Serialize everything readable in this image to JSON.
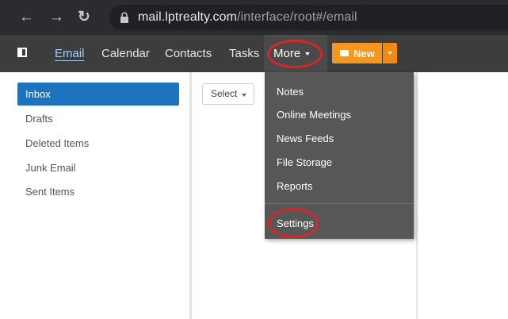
{
  "browser": {
    "url_host": "mail.lptrealty.com",
    "url_path": "/interface/root#/email"
  },
  "nav": {
    "items": [
      "Email",
      "Calendar",
      "Contacts",
      "Tasks"
    ],
    "more_label": "More",
    "new_label": "New"
  },
  "sidebar": {
    "folders": [
      "Inbox",
      "Drafts",
      "Deleted Items",
      "Junk Email",
      "Sent Items"
    ],
    "selected": "Inbox"
  },
  "list": {
    "select_label": "Select"
  },
  "more_menu": {
    "items": [
      "Notes",
      "Online Meetings",
      "News Feeds",
      "File Storage",
      "Reports"
    ],
    "settings": "Settings"
  },
  "colors": {
    "accent_blue": "#1e73be",
    "new_orange": "#f5961e",
    "highlight_red": "#d7262b"
  }
}
